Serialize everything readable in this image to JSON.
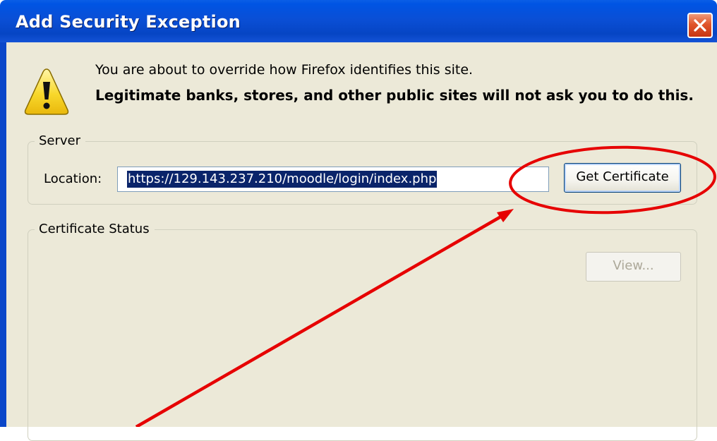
{
  "dialog": {
    "title": "Add Security Exception"
  },
  "message": {
    "line1": "You are about to override how Firefox identifies this site.",
    "line2": "Legitimate banks, stores, and other public sites will not ask you to do this."
  },
  "server": {
    "legend": "Server",
    "location_label": "Location:",
    "location_value": "https://129.143.237.210/moodle/login/index.php",
    "get_certificate_label": "Get Certificate"
  },
  "certificate_status": {
    "legend": "Certificate Status",
    "view_label": "View..."
  },
  "icons": {
    "warning": "warning-icon",
    "close": "close-icon"
  },
  "colors": {
    "titlebar": "#0054e3",
    "dialog_bg": "#ece9d8",
    "selection": "#0a246a",
    "annotation": "#e60000",
    "close_button": "#e0552c"
  }
}
